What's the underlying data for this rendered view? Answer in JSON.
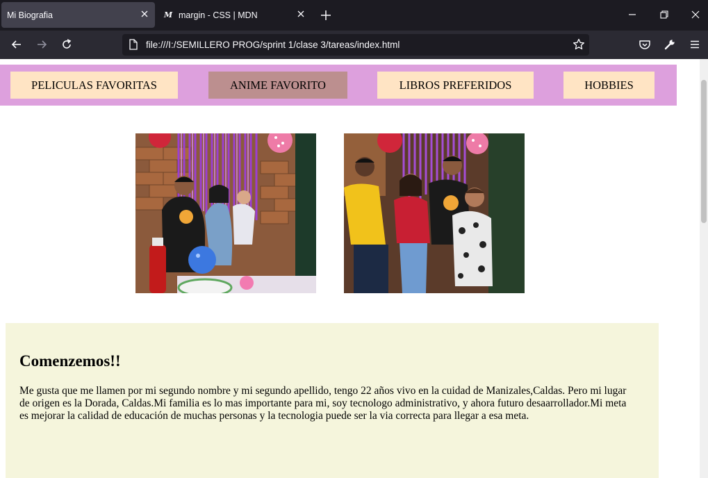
{
  "browser": {
    "tabs": [
      {
        "title": "Mi Biografia",
        "active": true
      },
      {
        "title": "margin - CSS | MDN",
        "active": false,
        "favicon": "M"
      }
    ],
    "url": "file:///I:/SEMILLERO PROG/sprint 1/clase 3/tareas/index.html"
  },
  "page": {
    "nav": [
      {
        "label": "PELICULAS FAVORITAS"
      },
      {
        "label": "ANIME FAVORITO"
      },
      {
        "label": "LIBROS PREFERIDOS"
      },
      {
        "label": "HOBBIES"
      }
    ],
    "bio": {
      "title": "Comenzemos!!",
      "text": "Me gusta que me llamen por mi segundo nombre y mi segundo apellido, tengo 22 años vivo en la cuidad de Manizales,Caldas. Pero mi lugar de origen es la Dorada, Caldas.Mi familia es lo mas importante para mi, soy tecnologo administrativo, y ahora futuro desaarrollador.Mi meta es mejorar la calidad de educación de muchas personas y la tecnologia puede ser la via correcta para llegar a esa meta."
    }
  },
  "colors": {
    "nav_background": "#dda0dd",
    "menu_button": "#ffe4c4",
    "menu_button_selected": "#bc8f8f",
    "bio_background": "#f5f5dc"
  }
}
